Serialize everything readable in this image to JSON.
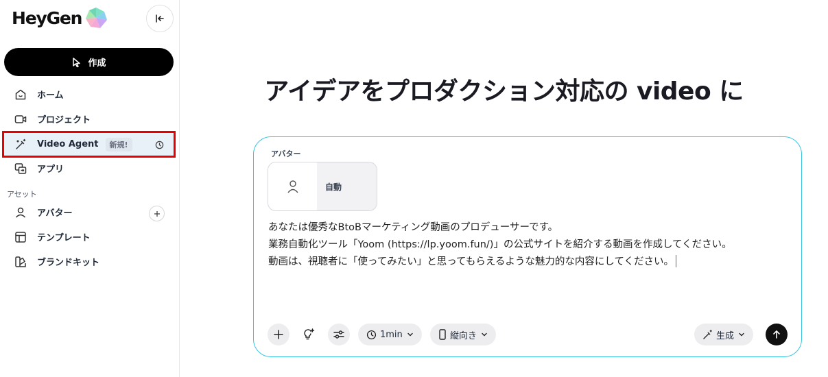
{
  "brand": {
    "name": "HeyGen"
  },
  "sidebar": {
    "create_label": "作成",
    "items": [
      {
        "label": "ホーム",
        "icon": "home-icon"
      },
      {
        "label": "プロジェクト",
        "icon": "video-camera-icon"
      },
      {
        "label": "Video Agent",
        "icon": "magic-wand-icon",
        "badge": "新規!",
        "active": true
      },
      {
        "label": "アプリ",
        "icon": "apps-icon"
      }
    ],
    "section_label": "アセット",
    "asset_items": [
      {
        "label": "アバター",
        "icon": "user-icon"
      },
      {
        "label": "テンプレート",
        "icon": "template-icon"
      },
      {
        "label": "ブランドキット",
        "icon": "brand-kit-icon"
      }
    ]
  },
  "main": {
    "headline": "アイデアをプロダクション対応の video に",
    "avatar_label": "アバター",
    "avatar_option": "自動",
    "prompt_text": "あなたは優秀なBtoBマーケティング動画のプロデューサーです。\n業務自動化ツール「Yoom (https://lp.yoom.fun/)」の公式サイトを紹介する動画を作成してください。\n動画は、視聴者に「使ってみたい」と思ってもらえるような魅力的な内容にしてください。",
    "duration": "1min",
    "orientation": "縦向き",
    "generate_label": "生成"
  },
  "colors": {
    "card_border": "#38c6e0",
    "active_bg": "#e8f0f8",
    "highlight_outline": "#e60000"
  }
}
